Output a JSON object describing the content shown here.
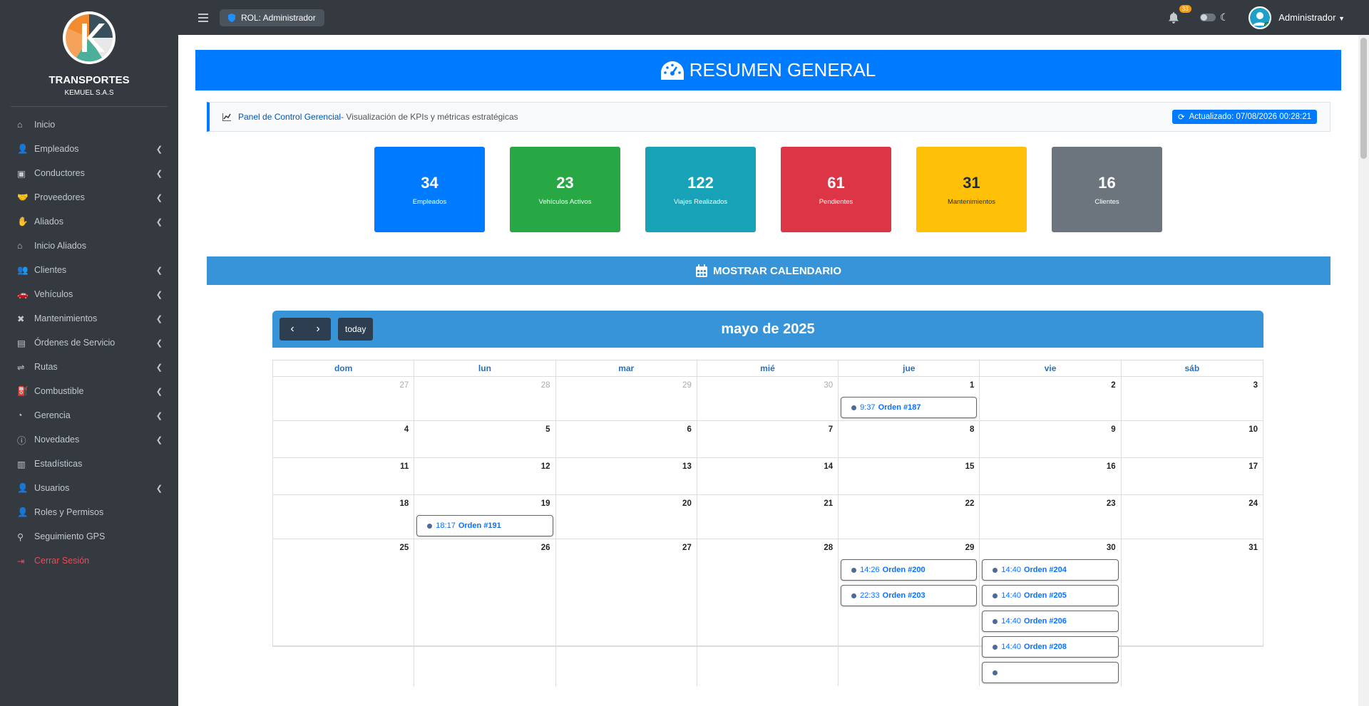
{
  "brand": {
    "title": "TRANSPORTES",
    "subtitle": "KEMUEL S.A.S",
    "logo_colors": [
      "#f28b30",
      "#4caf9a",
      "#3a4f5c"
    ]
  },
  "sidebar": {
    "items": [
      {
        "label": "Inicio",
        "icon": "home-icon",
        "chevron": false
      },
      {
        "label": "Empleados",
        "icon": "user-icon",
        "chevron": true
      },
      {
        "label": "Conductores",
        "icon": "id-card-icon",
        "chevron": true
      },
      {
        "label": "Proveedores",
        "icon": "handshake-icon",
        "chevron": true
      },
      {
        "label": "Aliados",
        "icon": "hand-icon",
        "chevron": true
      },
      {
        "label": "Inicio Aliados",
        "icon": "home-icon",
        "chevron": false
      },
      {
        "label": "Clientes",
        "icon": "users-icon",
        "chevron": true
      },
      {
        "label": "Vehículos",
        "icon": "car-icon",
        "chevron": true
      },
      {
        "label": "Mantenimientos",
        "icon": "tools-icon",
        "chevron": true
      },
      {
        "label": "Órdenes de Servicio",
        "icon": "clipboard-icon",
        "chevron": true
      },
      {
        "label": "Rutas",
        "icon": "route-icon",
        "chevron": true
      },
      {
        "label": "Combustible",
        "icon": "fuel-icon",
        "chevron": true
      },
      {
        "label": "Gerencia",
        "icon": "pie-chart-icon",
        "chevron": true
      },
      {
        "label": "Novedades",
        "icon": "alert-icon",
        "chevron": true
      },
      {
        "label": "Estadísticas",
        "icon": "bar-chart-icon",
        "chevron": false
      },
      {
        "label": "Usuarios",
        "icon": "user-icon",
        "chevron": true
      },
      {
        "label": "Roles y Permisos",
        "icon": "user-lock-icon",
        "chevron": false
      },
      {
        "label": "Seguimiento GPS",
        "icon": "map-marker-icon",
        "chevron": false
      },
      {
        "label": "Cerrar Sesión",
        "icon": "logout-icon",
        "chevron": false
      }
    ]
  },
  "topbar": {
    "role": "ROL: Administrador",
    "notifications": "33",
    "user": "Administrador"
  },
  "header": {
    "title": "RESUMEN GENERAL"
  },
  "info": {
    "link": "Panel de Control Gerencial",
    "text": " - Visualización de KPIs y métricas estratégicas",
    "updated": "Actualizado: 07/08/2026 00:28:21"
  },
  "kpis": [
    {
      "value": "34",
      "label": "Empleados",
      "color": "#007bff"
    },
    {
      "value": "23",
      "label": "Vehículos Activos",
      "color": "#28a745"
    },
    {
      "value": "122",
      "label": "Viajes Realizados",
      "color": "#17a2b8"
    },
    {
      "value": "61",
      "label": "Pendientes",
      "color": "#dc3545"
    },
    {
      "value": "31",
      "label": "Mantenimientos",
      "color": "#ffc107"
    },
    {
      "value": "16",
      "label": "Clientes",
      "color": "#6c757d"
    }
  ],
  "calendar_toggle": "MOSTRAR CALENDARIO",
  "calendar": {
    "title": "mayo de 2025",
    "today": "today",
    "days_of_week": [
      "dom",
      "lun",
      "mar",
      "mié",
      "jue",
      "vie",
      "sáb"
    ],
    "weeks": [
      [
        {
          "n": "27",
          "other": true,
          "events": []
        },
        {
          "n": "28",
          "other": true,
          "events": []
        },
        {
          "n": "29",
          "other": true,
          "events": []
        },
        {
          "n": "30",
          "other": true,
          "events": []
        },
        {
          "n": "1",
          "events": [
            {
              "time": "9:37",
              "title": "Orden #187"
            }
          ]
        },
        {
          "n": "2",
          "events": []
        },
        {
          "n": "3",
          "events": []
        }
      ],
      [
        {
          "n": "4",
          "events": []
        },
        {
          "n": "5",
          "events": []
        },
        {
          "n": "6",
          "events": []
        },
        {
          "n": "7",
          "events": []
        },
        {
          "n": "8",
          "events": []
        },
        {
          "n": "9",
          "events": []
        },
        {
          "n": "10",
          "events": []
        }
      ],
      [
        {
          "n": "11",
          "events": []
        },
        {
          "n": "12",
          "events": []
        },
        {
          "n": "13",
          "events": []
        },
        {
          "n": "14",
          "events": []
        },
        {
          "n": "15",
          "events": []
        },
        {
          "n": "16",
          "events": []
        },
        {
          "n": "17",
          "events": []
        }
      ],
      [
        {
          "n": "18",
          "events": []
        },
        {
          "n": "19",
          "events": [
            {
              "time": "18:17",
              "title": "Orden #191"
            }
          ]
        },
        {
          "n": "20",
          "events": []
        },
        {
          "n": "21",
          "events": []
        },
        {
          "n": "22",
          "events": []
        },
        {
          "n": "23",
          "events": []
        },
        {
          "n": "24",
          "events": []
        }
      ],
      [
        {
          "n": "25",
          "events": []
        },
        {
          "n": "26",
          "events": []
        },
        {
          "n": "27",
          "events": []
        },
        {
          "n": "28",
          "events": []
        },
        {
          "n": "29",
          "events": [
            {
              "time": "14:26",
              "title": "Orden #200"
            },
            {
              "time": "22:33",
              "title": "Orden #203"
            }
          ]
        },
        {
          "n": "30",
          "events": [
            {
              "time": "14:40",
              "title": "Orden #204"
            },
            {
              "time": "14:40",
              "title": "Orden #205"
            },
            {
              "time": "14:40",
              "title": "Orden #206"
            },
            {
              "time": "14:40",
              "title": "Orden #208"
            },
            {
              "time": "",
              "title": ""
            }
          ]
        },
        {
          "n": "31",
          "events": []
        }
      ]
    ]
  }
}
